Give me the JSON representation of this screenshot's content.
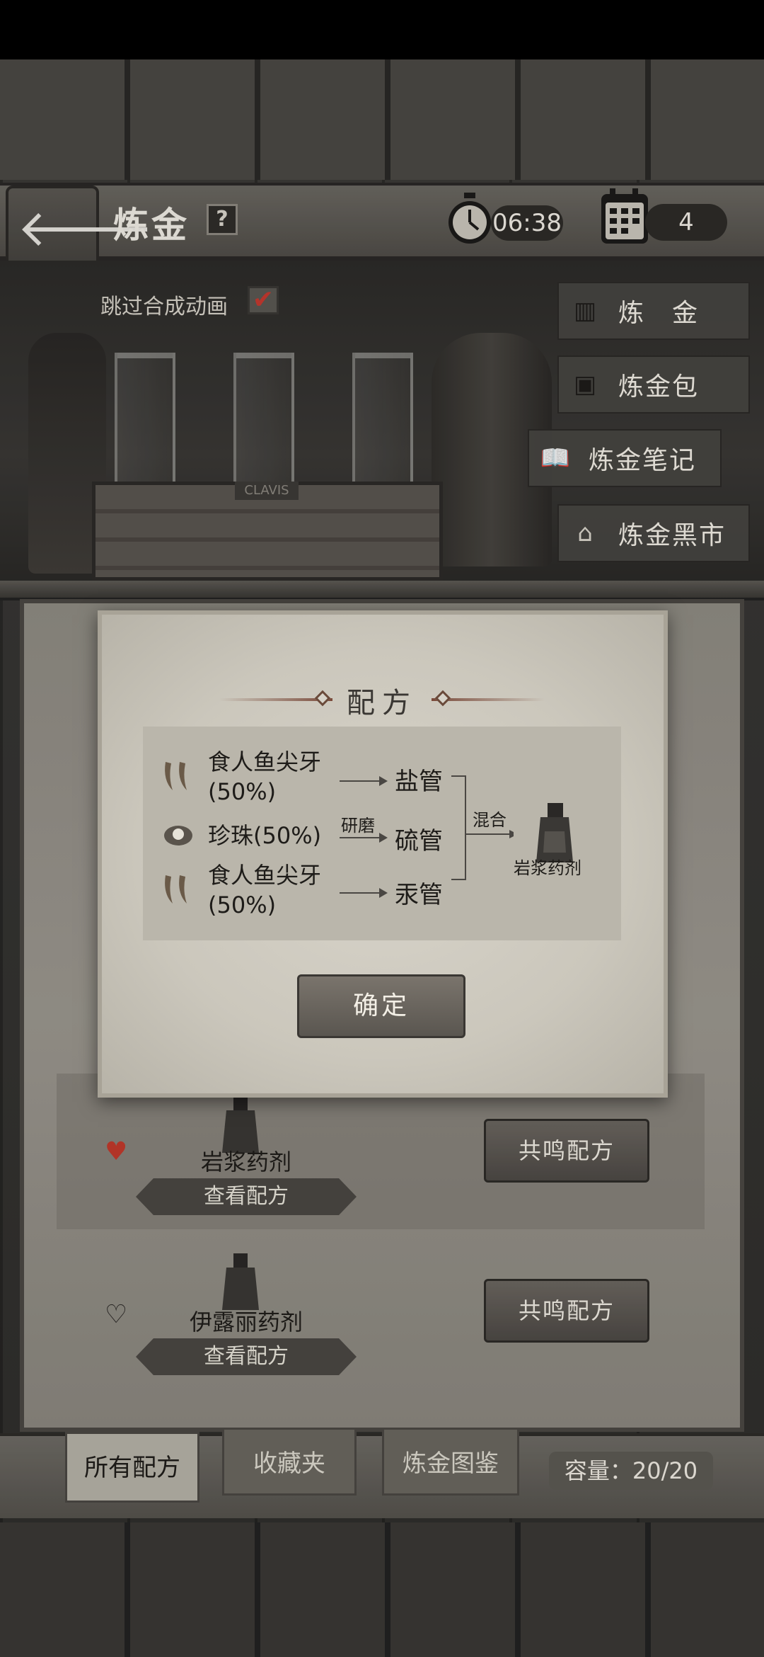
{
  "header": {
    "title": "炼金",
    "help": "?",
    "time": "06:38",
    "day": "4"
  },
  "scene": {
    "skip_animation_label": "跳过合成动画",
    "skip_checked": true,
    "rack_label": "CLAVIS"
  },
  "side_menu": [
    {
      "label": "炼　金",
      "icon": "lantern-icon"
    },
    {
      "label": "炼金包",
      "icon": "bag-icon"
    },
    {
      "label": "炼金笔记",
      "icon": "book-icon"
    },
    {
      "label": "炼金黑市",
      "icon": "house-icon"
    }
  ],
  "recipes": [
    {
      "name": "岩浆药剂",
      "favorite": true,
      "view": "查看配方",
      "resonate": "共鸣配方"
    },
    {
      "name": "伊露丽药剂",
      "favorite": false,
      "view": "查看配方",
      "resonate": "共鸣配方"
    }
  ],
  "tabs": {
    "all": "所有配方",
    "favorites": "收藏夹",
    "codex": "炼金图鉴"
  },
  "capacity": "容量：20/20",
  "dialog": {
    "title": "配方",
    "ingredients": [
      {
        "line1": "食人鱼尖牙",
        "line2": "(50%)",
        "icon": "fang-icon",
        "tube": "盐管",
        "process": ""
      },
      {
        "line1": "珍珠(50%)",
        "line2": "",
        "icon": "pearl-icon",
        "tube": "硫管",
        "process": "研磨"
      },
      {
        "line1": "食人鱼尖牙",
        "line2": "(50%)",
        "icon": "fang-icon",
        "tube": "汞管",
        "process": ""
      }
    ],
    "mix_label": "混合",
    "result": "岩浆药剂",
    "confirm": "确定"
  },
  "colors": {
    "heart_filled": "#c0392b",
    "parchment": "#cbc7bc",
    "wood_dark": "#2e2d2b"
  }
}
